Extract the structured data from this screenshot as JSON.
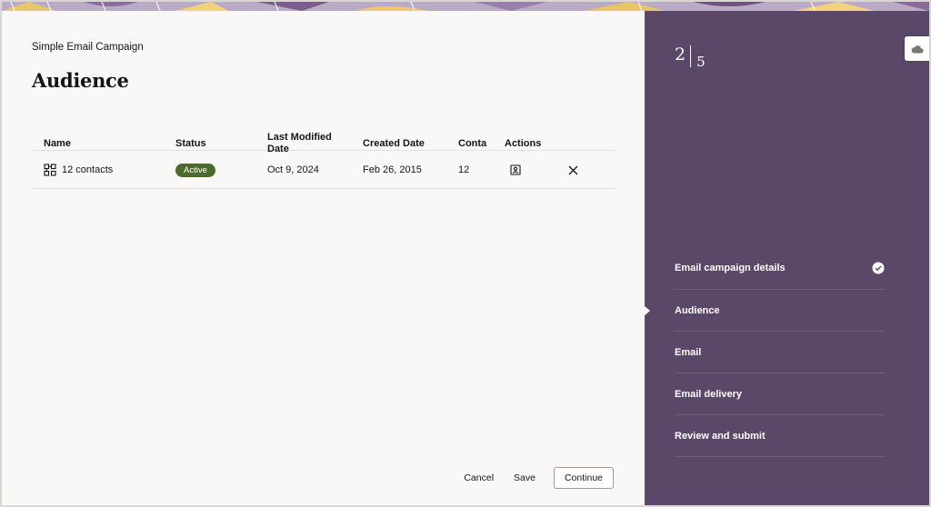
{
  "campaign": {
    "name": "Simple Email Campaign"
  },
  "page": {
    "title": "Audience"
  },
  "table": {
    "headers": {
      "name": "Name",
      "status": "Status",
      "last_modified_line1": "Last Modified",
      "last_modified_line2": "Date",
      "created": "Created Date",
      "contacts": "Conta",
      "actions": "Actions"
    },
    "rows": [
      {
        "name": "12 contacts",
        "name_icon": "hierarchy-icon",
        "status": "Active",
        "last_modified": "Oct 9, 2024",
        "created": "Feb 26, 2015",
        "contacts": "12",
        "action_icon": "contact-card-icon",
        "remove_icon": "close-icon"
      }
    ]
  },
  "footer": {
    "cancel": "Cancel",
    "save": "Save",
    "continue": "Continue"
  },
  "wizard": {
    "current": "2",
    "total": "5",
    "steps": [
      {
        "label": "Email campaign details",
        "state": "complete"
      },
      {
        "label": "Audience",
        "state": "current"
      },
      {
        "label": "Email",
        "state": "pending"
      },
      {
        "label": "Email delivery",
        "state": "pending"
      },
      {
        "label": "Review and submit",
        "state": "pending"
      }
    ]
  },
  "side_tab": {
    "icon": "cloud-icon"
  },
  "colors": {
    "sidebar": "#5b4767",
    "badge_active": "#4b6b2a",
    "page_bg": "#f9f8f6"
  }
}
